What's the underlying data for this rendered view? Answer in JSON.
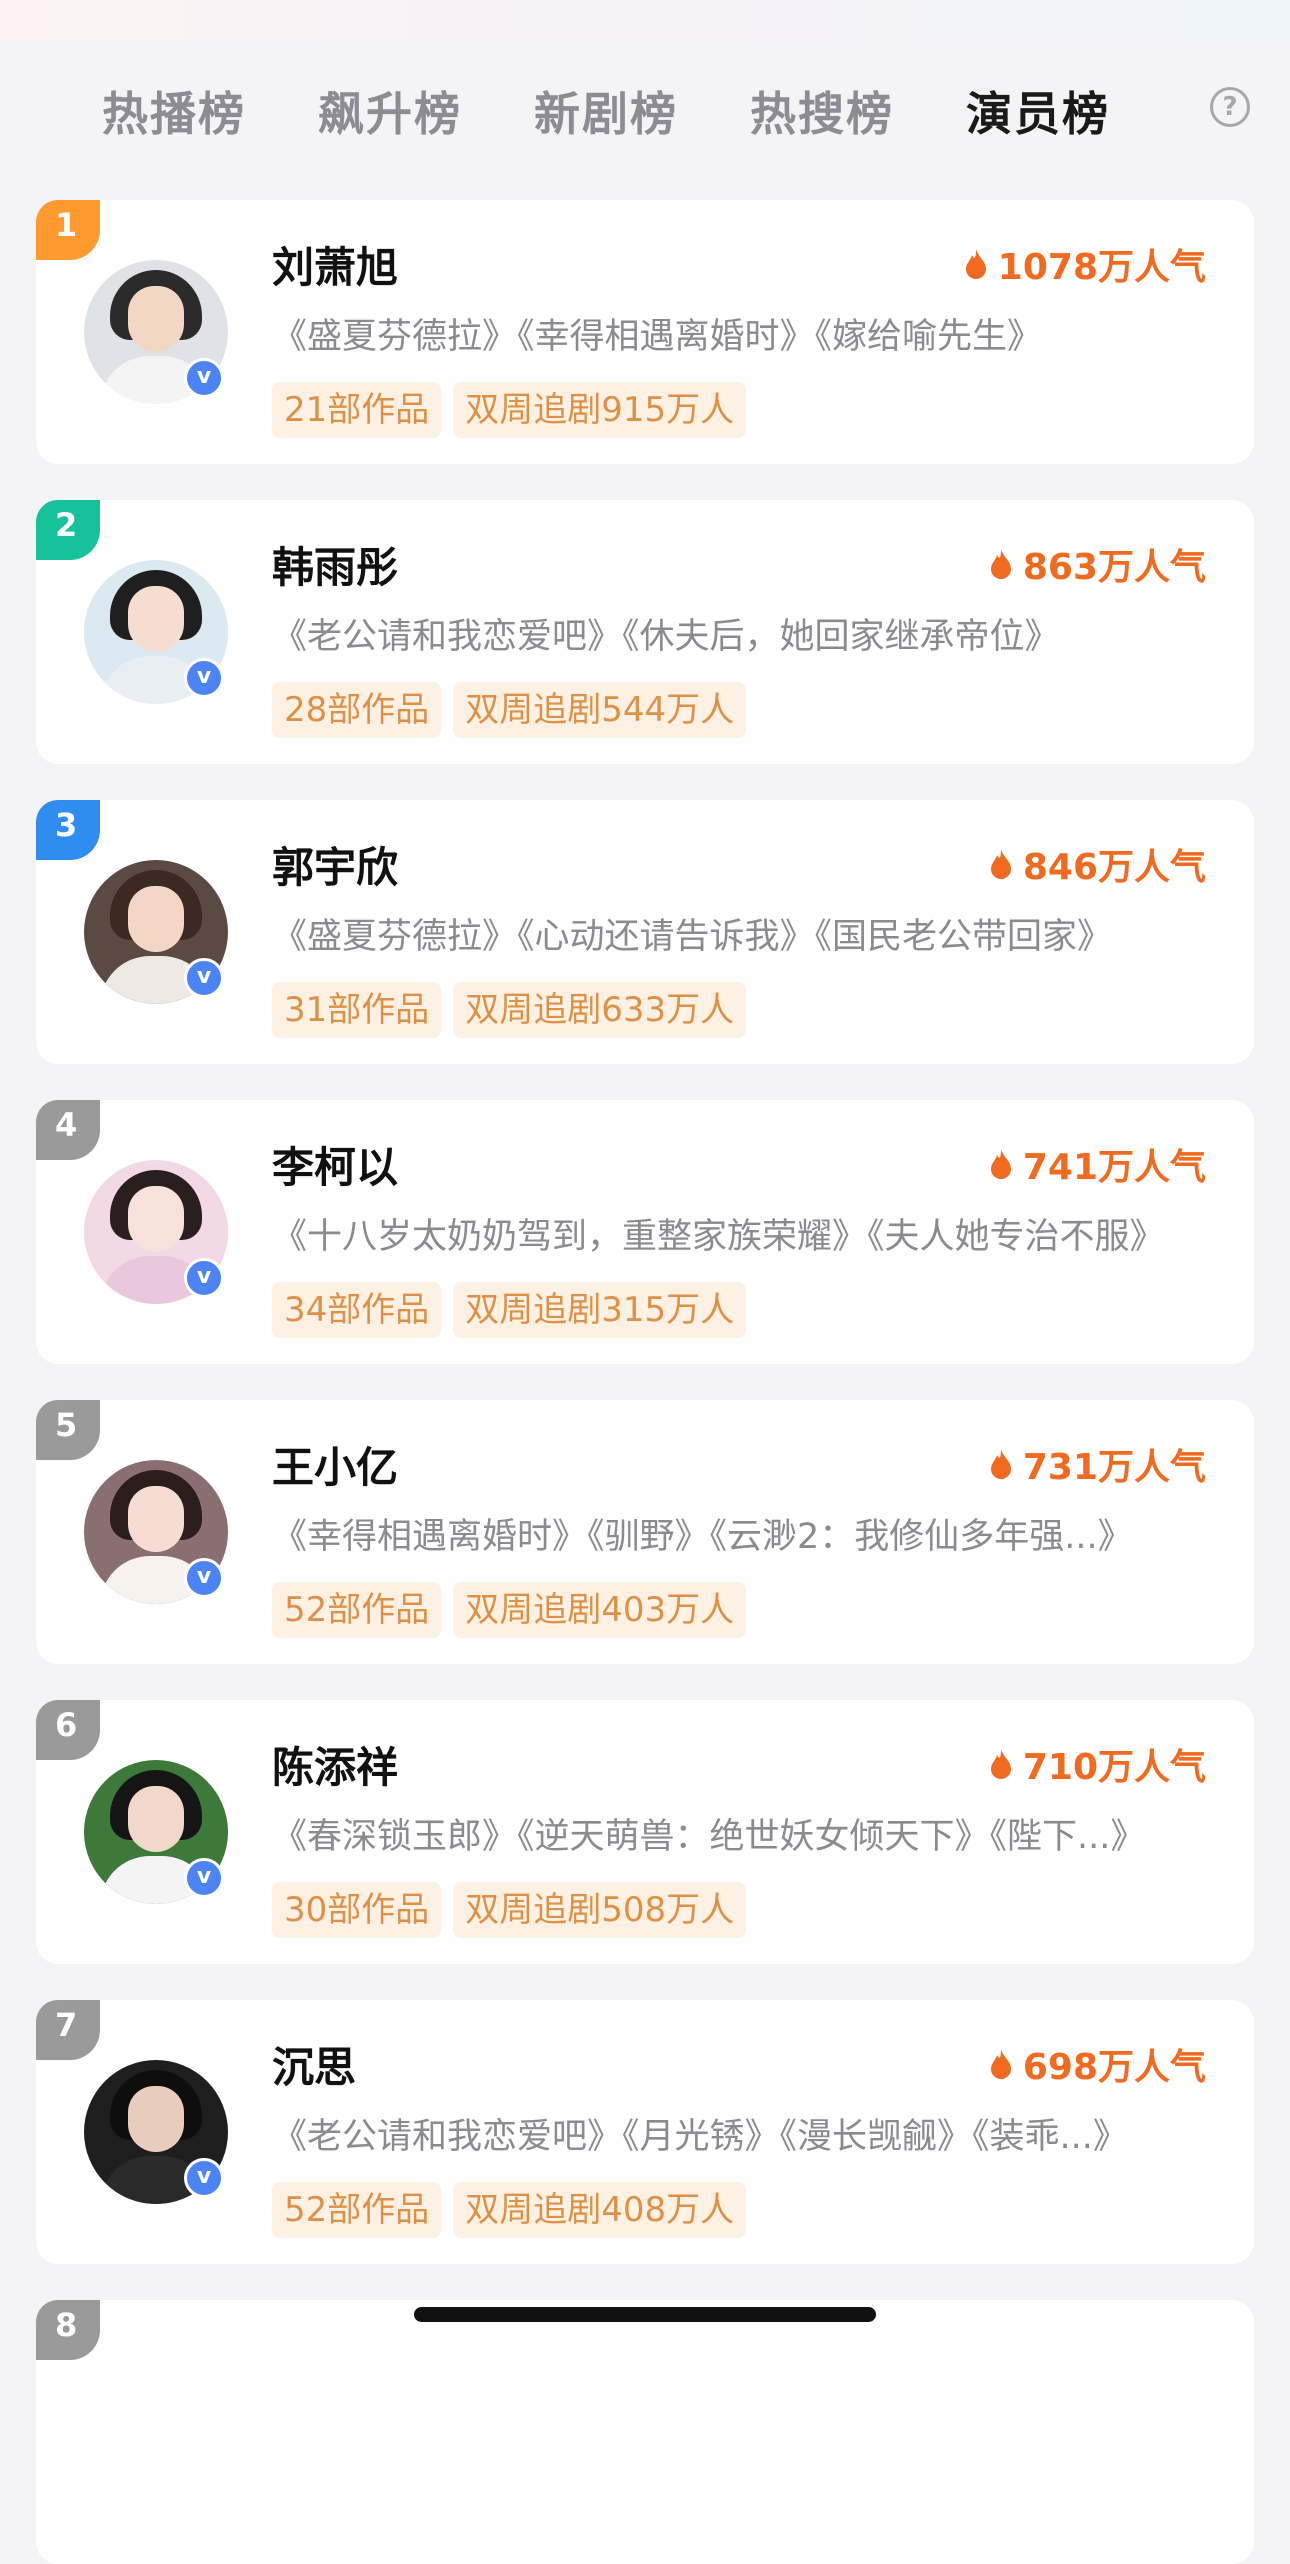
{
  "tabs": [
    {
      "label": "热播榜"
    },
    {
      "label": "飙升榜"
    },
    {
      "label": "新剧榜"
    },
    {
      "label": "热搜榜"
    },
    {
      "label": "演员榜",
      "active": true
    }
  ],
  "help_icon": {
    "glyph": "?",
    "name": "help-icon"
  },
  "actors": [
    {
      "rank": "1",
      "name": "刘萧旭",
      "heat": "1078万人气",
      "works": "《盛夏芬德拉》《幸得相遇离婚时》《嫁给喻先生》",
      "tag_works": "21部作品",
      "tag_follow": "双周追剧915万人"
    },
    {
      "rank": "2",
      "name": "韩雨彤",
      "heat": "863万人气",
      "works": "《老公请和我恋爱吧》《休夫后，她回家继承帝位》",
      "tag_works": "28部作品",
      "tag_follow": "双周追剧544万人"
    },
    {
      "rank": "3",
      "name": "郭宇欣",
      "heat": "846万人气",
      "works": "《盛夏芬德拉》《心动还请告诉我》《国民老公带回家》",
      "tag_works": "31部作品",
      "tag_follow": "双周追剧633万人"
    },
    {
      "rank": "4",
      "name": "李柯以",
      "heat": "741万人气",
      "works": "《十八岁太奶奶驾到，重整家族荣耀》《夫人她专治不服》",
      "tag_works": "34部作品",
      "tag_follow": "双周追剧315万人"
    },
    {
      "rank": "5",
      "name": "王小亿",
      "heat": "731万人气",
      "works": "《幸得相遇离婚时》《驯野》《云渺2：我修仙多年强...》",
      "tag_works": "52部作品",
      "tag_follow": "双周追剧403万人"
    },
    {
      "rank": "6",
      "name": "陈添祥",
      "heat": "710万人气",
      "works": "《春深锁玉郎》《逆天萌兽：绝世妖女倾天下》《陛下...》",
      "tag_works": "30部作品",
      "tag_follow": "双周追剧508万人"
    },
    {
      "rank": "7",
      "name": "沉思",
      "heat": "698万人气",
      "works": "《老公请和我恋爱吧》《月光锈》《漫长觊觎》《装乖...》",
      "tag_works": "52部作品",
      "tag_follow": "双周追剧408万人"
    },
    {
      "rank": "8",
      "name": "",
      "heat": "",
      "works": "",
      "tag_works": "",
      "tag_follow": ""
    }
  ],
  "verified_glyph": "v",
  "colors": {
    "rank1": "#ff9a2e",
    "rank2": "#16c29a",
    "rank3": "#2f8df0",
    "rank_other": "#9a9a9a",
    "heat": "#f06a1f",
    "tag_text": "#dd9146",
    "tag_bg": "#fdf1e4",
    "verified": "#4c84f3"
  }
}
